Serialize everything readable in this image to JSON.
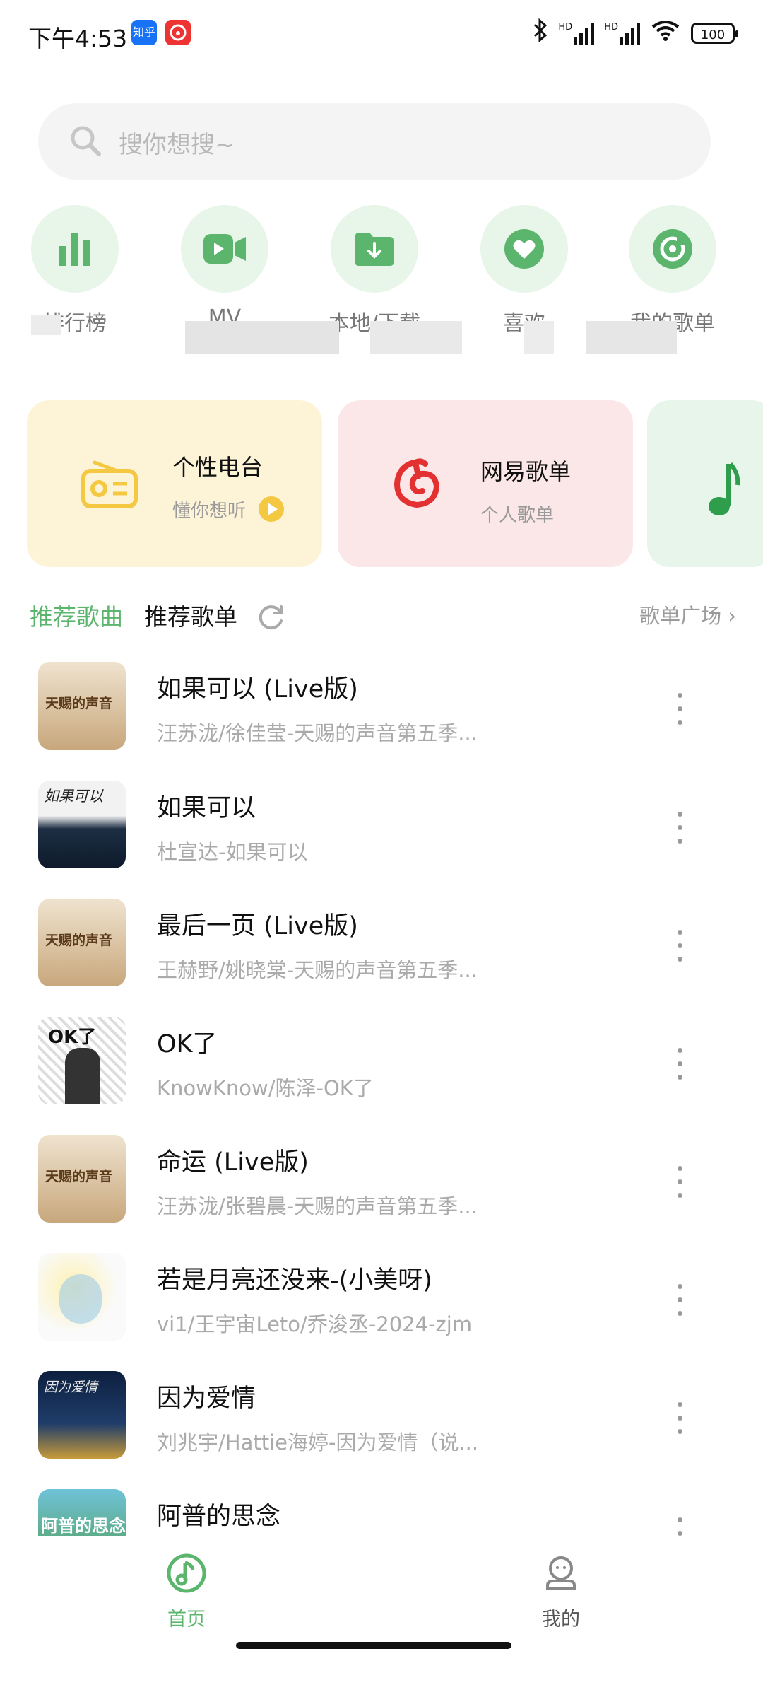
{
  "status_bar": {
    "time": "下午4:53",
    "zhihu_badge": "知乎",
    "network": "HD",
    "battery": "100"
  },
  "search": {
    "placeholder": "搜你想搜~"
  },
  "quick_nav": [
    {
      "label": "排行榜",
      "icon": "chart-icon"
    },
    {
      "label": "MV",
      "icon": "video-icon"
    },
    {
      "label": "本地/下载",
      "icon": "download-folder-icon"
    },
    {
      "label": "喜欢",
      "icon": "heart-icon"
    },
    {
      "label": "我的歌单",
      "icon": "disc-icon"
    }
  ],
  "cards": [
    {
      "title": "个性电台",
      "subtitle": "懂你想听",
      "icon": "radio-icon"
    },
    {
      "title": "网易歌单",
      "subtitle": "个人歌单",
      "icon": "netease-logo-icon"
    },
    {
      "title": "",
      "subtitle": "",
      "icon": "music-note-icon"
    }
  ],
  "section": {
    "tab_active": "推荐歌曲",
    "tab_inactive": "推荐歌单",
    "plaza": "歌单广场"
  },
  "songs": [
    {
      "title": "如果可以 (Live版)",
      "subtitle": "汪苏泷/徐佳莹-天赐的声音第五季...",
      "cover_text": "天赐的声音"
    },
    {
      "title": "如果可以",
      "subtitle": "杜宣达-如果可以",
      "cover_text": "如果可以"
    },
    {
      "title": "最后一页 (Live版)",
      "subtitle": "王赫野/姚晓棠-天赐的声音第五季...",
      "cover_text": "天赐的声音"
    },
    {
      "title": "OK了",
      "subtitle": "KnowKnow/陈泽-OK了",
      "cover_text": "OK了"
    },
    {
      "title": "命运 (Live版)",
      "subtitle": "汪苏泷/张碧晨-天赐的声音第五季...",
      "cover_text": "天赐的声音"
    },
    {
      "title": "若是月亮还没来-(小美呀)",
      "subtitle": "vi1/王宇宙Leto/乔浚丞-2024-zjm",
      "cover_text": ""
    },
    {
      "title": "因为爱情",
      "subtitle": "刘兆宇/Hattie海婷-因为爱情（说...",
      "cover_text": "因为爱情"
    },
    {
      "title": "阿普的思念",
      "subtitle": "",
      "cover_text": "阿普的思念"
    }
  ],
  "bottom_nav": [
    {
      "label": "首页",
      "active": true
    },
    {
      "label": "我的",
      "active": false
    }
  ],
  "colors": {
    "accent": "#5bb56d",
    "card_yellow": "#fdf4d8",
    "card_pink": "#fbe7e7",
    "card_green": "#e8f5ea"
  }
}
